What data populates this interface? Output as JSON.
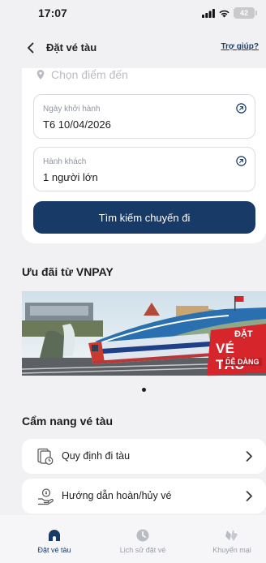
{
  "status": {
    "time": "17:07",
    "battery": "42"
  },
  "header": {
    "title": "Đặt vé tàu",
    "help": "Trợ giúp?"
  },
  "form": {
    "destination_placeholder": "Chọn điểm đến",
    "date_label": "Ngày khởi hành",
    "date_value": "T6 10/04/2026",
    "passenger_label": "Hành khách",
    "passenger_value": "1 người lớn",
    "search_button": "Tìm kiếm chuyến đi"
  },
  "promo": {
    "title": "Ưu đãi từ VNPAY",
    "banner": {
      "line1": "ĐẶT",
      "line2": "VÉ TÀU",
      "line3": "DỄ DÀNG"
    }
  },
  "guide": {
    "title": "Cẩm nang vé tàu",
    "items": [
      {
        "label": "Quy định đi tàu",
        "icon": "document-clock-icon"
      },
      {
        "label": "Hướng dẫn hoàn/hủy vé",
        "icon": "refund-hand-icon"
      }
    ]
  },
  "nav": {
    "items": [
      {
        "label": "Đặt vé tàu",
        "icon": "train-icon",
        "active": true
      },
      {
        "label": "Lịch sử đặt vé",
        "icon": "history-icon",
        "active": false
      },
      {
        "label": "Khuyến mại",
        "icon": "promotion-icon",
        "active": false
      }
    ]
  },
  "colors": {
    "primary": "#173a66",
    "background": "#f1f1f3",
    "banner_red": "#d7262b"
  }
}
